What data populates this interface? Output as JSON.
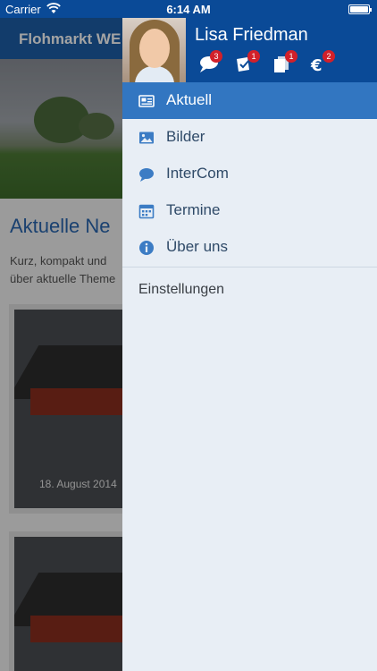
{
  "status_bar": {
    "carrier": "Carrier",
    "time": "6:14 AM"
  },
  "background_page": {
    "nav_title": "Flohmarkt WE",
    "section_title": "Aktuelle Ne",
    "section_text_line1": "Kurz, kompakt und",
    "section_text_line2": "über aktuelle Theme",
    "card_date": "18. August 2014"
  },
  "drawer": {
    "user_name": "Lisa Friedman",
    "badges": [
      {
        "icon": "chat-bubbles-icon",
        "count": "3"
      },
      {
        "icon": "tasks-icon",
        "count": "1"
      },
      {
        "icon": "documents-icon",
        "count": "1"
      },
      {
        "icon": "euro-icon",
        "count": "2"
      }
    ],
    "menu": [
      {
        "icon": "news-icon",
        "label": "Aktuell",
        "active": true
      },
      {
        "icon": "image-icon",
        "label": "Bilder",
        "active": false
      },
      {
        "icon": "chat-icon",
        "label": "InterCom",
        "active": false
      },
      {
        "icon": "calendar-icon",
        "label": "Termine",
        "active": false
      },
      {
        "icon": "info-icon",
        "label": "Über uns",
        "active": false
      }
    ],
    "settings_label": "Einstellungen"
  },
  "colors": {
    "header_blue": "#0a4a97",
    "active_blue": "#3276c1",
    "badge_red": "#d2202a",
    "drawer_bg": "#e8eef5",
    "icon_blue": "#3c7cc4"
  }
}
